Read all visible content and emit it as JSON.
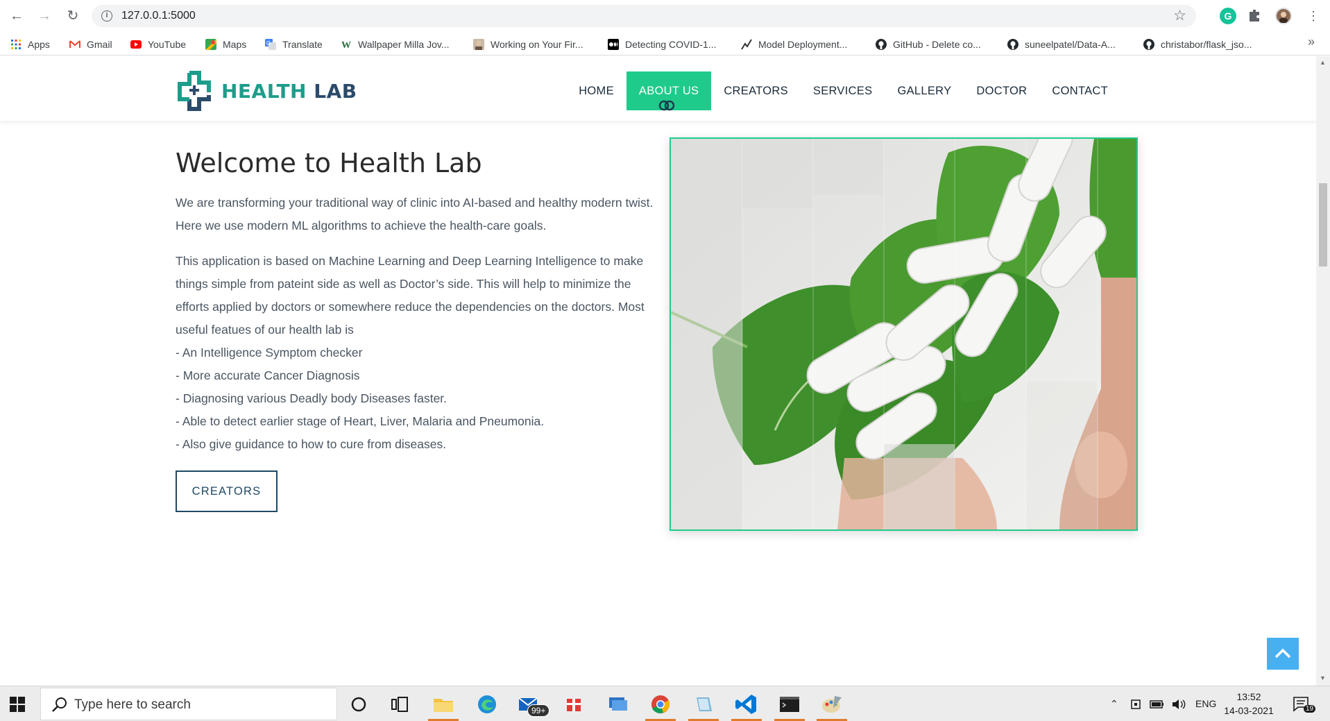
{
  "browser": {
    "url": "127.0.0.1:5000",
    "bookmarks": [
      {
        "label": "Apps",
        "icon": "apps-grid-icon"
      },
      {
        "label": "Gmail",
        "icon": "gmail-icon"
      },
      {
        "label": "YouTube",
        "icon": "youtube-icon"
      },
      {
        "label": "Maps",
        "icon": "maps-icon"
      },
      {
        "label": "Translate",
        "icon": "translate-icon"
      },
      {
        "label": "Wallpaper Milla Jov...",
        "icon": "wallpaper-icon"
      },
      {
        "label": "Working on Your Fir...",
        "icon": "avatar-icon"
      },
      {
        "label": "Detecting COVID-1...",
        "icon": "medium-icon"
      },
      {
        "label": "Model Deployment...",
        "icon": "chart-line-icon"
      },
      {
        "label": "GitHub - Delete co...",
        "icon": "github-icon"
      },
      {
        "label": "suneelpatel/Data-A...",
        "icon": "github-icon"
      },
      {
        "label": "christabor/flask_jso...",
        "icon": "github-icon"
      }
    ]
  },
  "site": {
    "logo_word1": "HEALTH",
    "logo_word2": "LAB",
    "menu": [
      "HOME",
      "ABOUT US",
      "CREATORS",
      "SERVICES",
      "GALLERY",
      "DOCTOR",
      "CONTACT"
    ],
    "active_menu": "ABOUT US",
    "accent_color": "#1fcb8b"
  },
  "about": {
    "title": "Welcome to Health Lab",
    "para1": "We are transforming your traditional way of clinic into AI-based and healthy modern twist. Here we use modern ML algorithms to achieve the health-care goals.",
    "para2_intro": "This application is based on Machine Learning and Deep Learning Intelligence to make things simple from pateint side as well as Doctor’s side. This will help to minimize the efforts applied by doctors or somewhere reduce the dependencies on the doctors. Most useful featues of our health lab is",
    "features": [
      "- An Intelligence Symptom checker",
      "- More accurate Cancer Diagnosis",
      "- Diagnosing various Deadly body Diseases faster.",
      "- Able to detect earlier stage of Heart, Liver, Malaria and Pneumonia.",
      "- Also give guidance to how to cure from diseases."
    ],
    "button_label": "CREATORS"
  },
  "taskbar": {
    "search_placeholder": "Type here to search",
    "mail_badge": "99+",
    "language": "ENG",
    "time": "13:52",
    "date": "14-03-2021",
    "notification_count": "19"
  }
}
